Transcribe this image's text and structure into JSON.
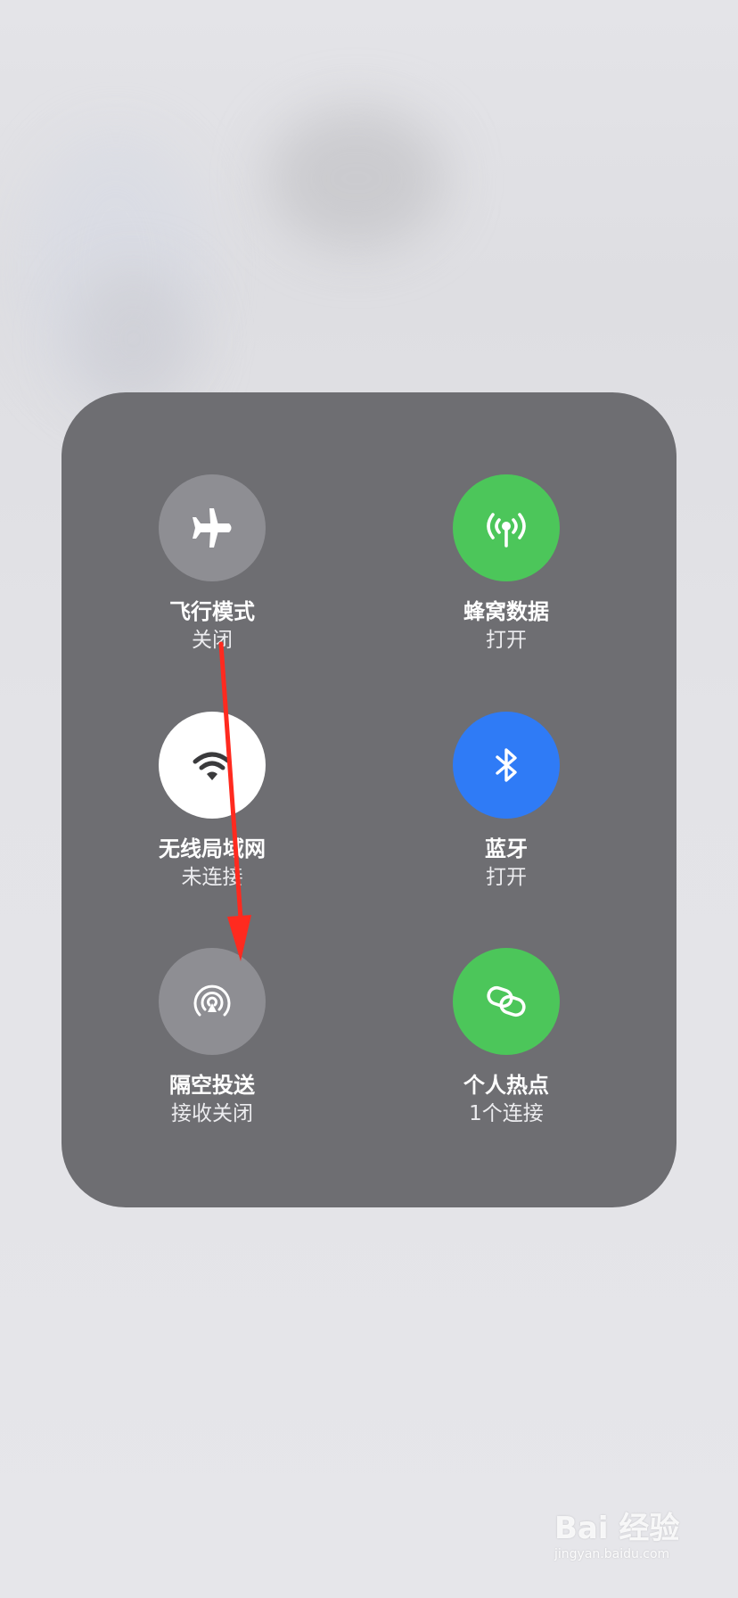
{
  "controls": [
    {
      "label": "飞行模式",
      "status": "关闭",
      "icon": "airplane-icon",
      "color": "#8e8e93"
    },
    {
      "label": "蜂窝数据",
      "status": "打开",
      "icon": "cellular-antenna-icon",
      "color": "#4cc65a"
    },
    {
      "label": "无线局域网",
      "status": "未连接",
      "icon": "wifi-icon",
      "color": "#ffffff"
    },
    {
      "label": "蓝牙",
      "status": "打开",
      "icon": "bluetooth-icon",
      "color": "#2f7bf6"
    },
    {
      "label": "隔空投送",
      "status": "接收关闭",
      "icon": "airdrop-icon",
      "color": "#8e8e93"
    },
    {
      "label": "个人热点",
      "status": "1个连接",
      "icon": "hotspot-link-icon",
      "color": "#4cc65a"
    }
  ],
  "annotation": {
    "color": "#ff2a1f"
  },
  "watermark": {
    "logo": "Bai  经验",
    "url": "jingyan.baidu.com"
  }
}
